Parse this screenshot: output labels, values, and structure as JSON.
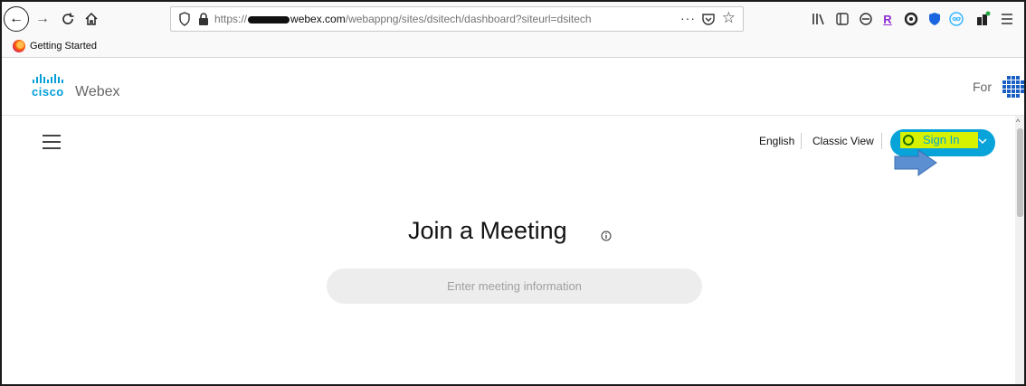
{
  "browser": {
    "url_prefix": "https://",
    "url_host_suffix": "webex.com",
    "url_path": "/webappng/sites/dsitech/dashboard?siteurl=dsitech",
    "more_label": "···",
    "bookmark_label": "Getting Started",
    "icons": [
      "back-icon",
      "forward-icon",
      "reload-icon",
      "home-icon",
      "shield-icon",
      "lock-icon",
      "pocket-icon",
      "star-icon",
      "library-icon",
      "sidebar-icon",
      "account-icon",
      "r-extension-icon",
      "extension-icon",
      "shield-extension-icon",
      "infinity-extension-icon",
      "profile-badge-icon",
      "menu-icon"
    ]
  },
  "header": {
    "brand_top": "cisco",
    "brand_product": "Webex",
    "for_label": "For"
  },
  "nav": {
    "language": "English",
    "classic_view": "Classic View",
    "sign_in": "Sign In"
  },
  "main": {
    "title": "Join a Meeting",
    "input_placeholder": "Enter meeting information"
  },
  "colors": {
    "accent": "#07a3d9",
    "highlight": "#d6f200",
    "cisco_blue": "#049fd9",
    "annotation_arrow": "#5b8fd1"
  }
}
